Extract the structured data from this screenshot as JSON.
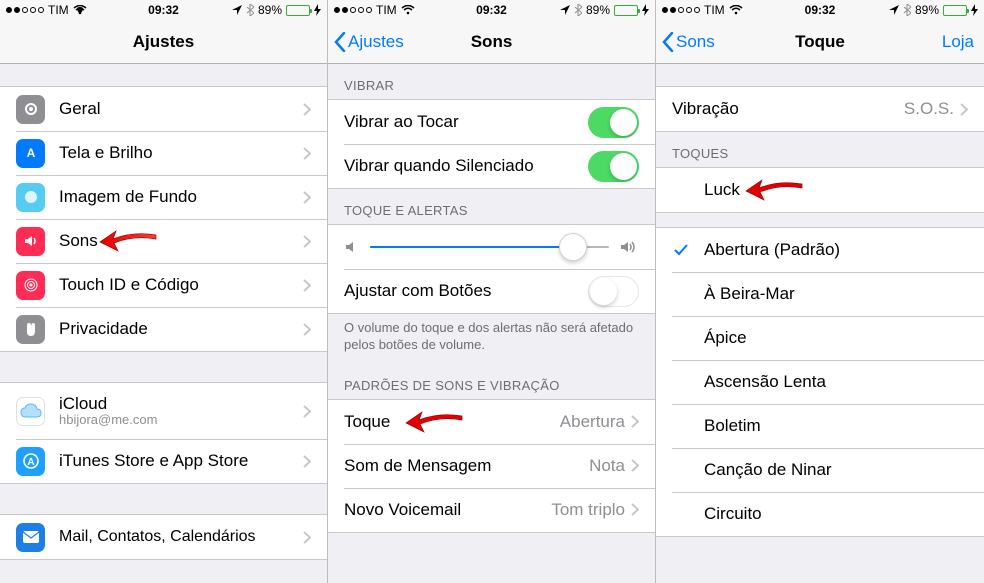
{
  "status": {
    "carrier": "TIM",
    "time": "09:32",
    "battery": "89%"
  },
  "screen1": {
    "title": "Ajustes",
    "group1": [
      {
        "label": "Geral"
      },
      {
        "label": "Tela e Brilho"
      },
      {
        "label": "Imagem de Fundo"
      },
      {
        "label": "Sons"
      },
      {
        "label": "Touch ID e Código"
      },
      {
        "label": "Privacidade"
      }
    ],
    "group2": [
      {
        "label": "iCloud",
        "sub": "hbijora@me.com"
      },
      {
        "label": "iTunes Store e App Store"
      }
    ],
    "group3": [
      {
        "label": "Mail, Contatos, Calendários"
      }
    ]
  },
  "screen2": {
    "back": "Ajustes",
    "title": "Sons",
    "header_vibrar": "VIBRAR",
    "vibrar_tocar": "Vibrar ao Tocar",
    "vibrar_sil": "Vibrar quando Silenciado",
    "header_toque": "TOQUE E ALERTAS",
    "ajustar_botoes": "Ajustar com Botões",
    "footer_toque": "O volume do toque e dos alertas não será afetado pelos botões de volume.",
    "header_padroes": "PADRÕES DE SONS E VIBRAÇÃO",
    "slider_value_pct": 85,
    "rows_padroes": [
      {
        "label": "Toque",
        "detail": "Abertura"
      },
      {
        "label": "Som de Mensagem",
        "detail": "Nota"
      },
      {
        "label": "Novo Voicemail",
        "detail": "Tom triplo"
      }
    ]
  },
  "screen3": {
    "back": "Sons",
    "title": "Toque",
    "right": "Loja",
    "row_vibracao": {
      "label": "Vibração",
      "detail": "S.O.S."
    },
    "header_toques": "TOQUES",
    "toques_custom": [
      {
        "label": "Luck",
        "checked": false
      }
    ],
    "toques_system": [
      {
        "label": "Abertura (Padrão)",
        "checked": true
      },
      {
        "label": "À Beira-Mar",
        "checked": false
      },
      {
        "label": "Ápice",
        "checked": false
      },
      {
        "label": "Ascensão Lenta",
        "checked": false
      },
      {
        "label": "Boletim",
        "checked": false
      },
      {
        "label": "Canção de Ninar",
        "checked": false
      },
      {
        "label": "Circuito",
        "checked": false
      }
    ]
  }
}
